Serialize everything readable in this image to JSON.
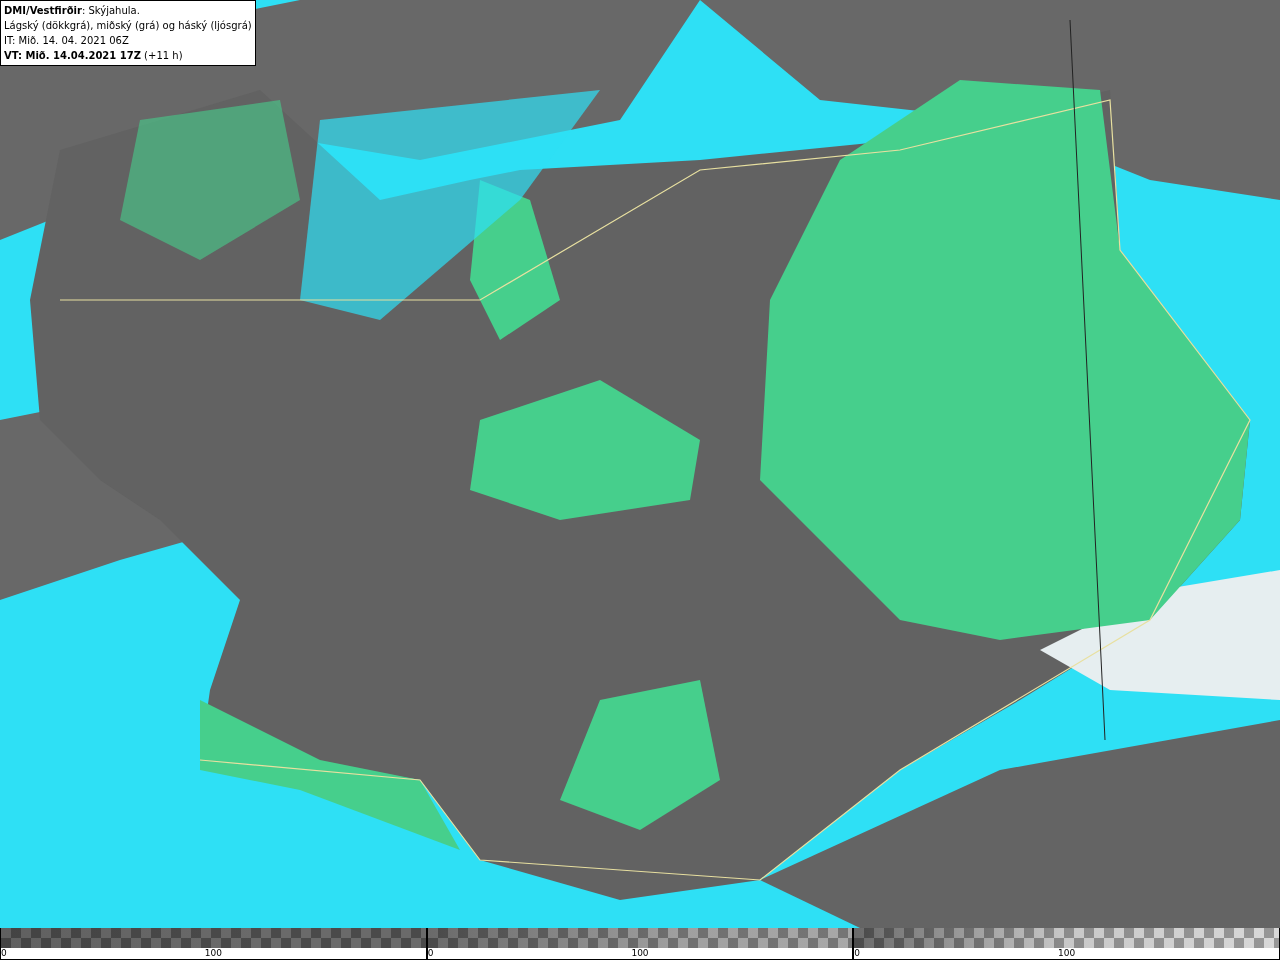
{
  "info_box": {
    "lines": [
      "**DMI/Vestfirðir**: Skýjahula.",
      "Lágský (dökkgrá), miðský (grá) og háský (ljósgrá)",
      "IT: Mið. 14. 04. 2021 06Z",
      "**VT: Mið. 14.04.2021 17Z** (+11 h)"
    ]
  },
  "legends": [
    {
      "kind": "low",
      "min_label": "0",
      "max_label": "100"
    },
    {
      "kind": "mid",
      "min_label": "0",
      "max_label": "100"
    },
    {
      "kind": "high",
      "min_label": "0",
      "max_label": "100"
    }
  ]
}
